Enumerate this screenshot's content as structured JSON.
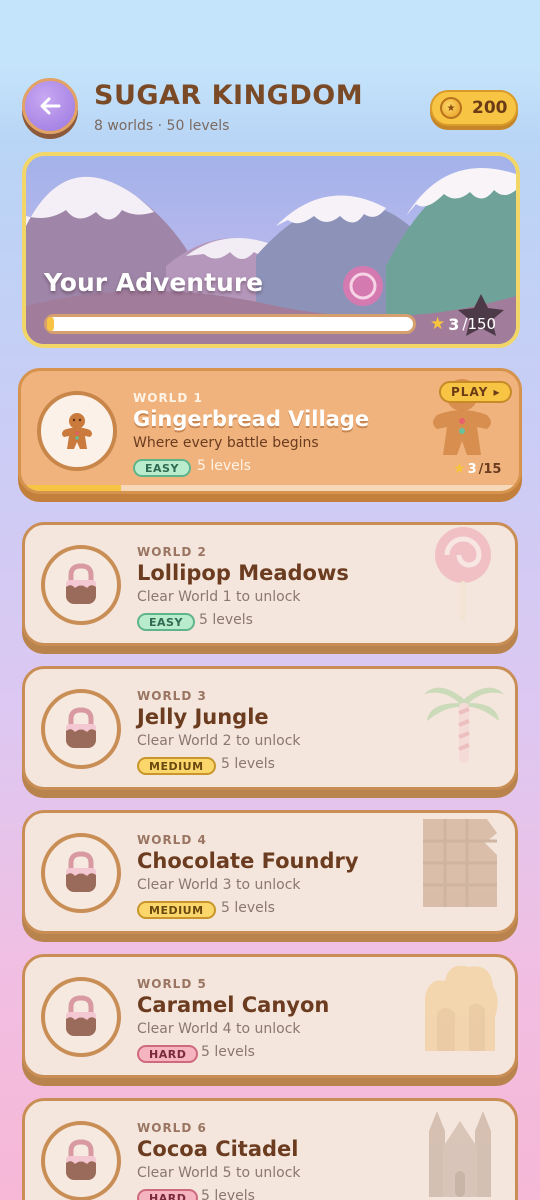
{
  "header": {
    "title": "SUGAR KINGDOM",
    "subtitle": "8 worlds · 50 levels",
    "coins": "200"
  },
  "banner": {
    "title": "Your Adventure",
    "stars_collected": "3",
    "stars_total": "/150",
    "progress_fraction": 0.02
  },
  "worlds": [
    {
      "number": "WORLD 1",
      "name": "Gingerbread Village",
      "description": "Where every battle begins",
      "difficulty": "EASY",
      "levels": "5 levels",
      "action": "PLAY ▸",
      "stars": "3",
      "stars_total": "/15",
      "progress_fraction": 0.2,
      "icon": "gingerbread-man-icon",
      "status": "unlocked"
    },
    {
      "number": "WORLD 2",
      "name": "Lollipop Meadows",
      "description": "Clear World 1 to unlock",
      "difficulty": "EASY",
      "levels": "5 levels",
      "icon": "lock-icon",
      "status": "locked"
    },
    {
      "number": "WORLD 3",
      "name": "Jelly Jungle",
      "description": "Clear World 2 to unlock",
      "difficulty": "MEDIUM",
      "levels": "5 levels",
      "icon": "lock-icon",
      "status": "locked"
    },
    {
      "number": "WORLD 4",
      "name": "Chocolate Foundry",
      "description": "Clear World 3 to unlock",
      "difficulty": "MEDIUM",
      "levels": "5 levels",
      "icon": "lock-icon",
      "status": "locked"
    },
    {
      "number": "WORLD 5",
      "name": "Caramel Canyon",
      "description": "Clear World 4 to unlock",
      "difficulty": "HARD",
      "levels": "5 levels",
      "icon": "lock-icon",
      "status": "locked"
    },
    {
      "number": "WORLD 6",
      "name": "Cocoa Citadel",
      "description": "Clear World 5 to unlock",
      "difficulty": "HARD",
      "levels": "5 levels",
      "icon": "lock-icon",
      "status": "locked"
    }
  ],
  "colors": {
    "title_brown": "#7a4a26",
    "coin_gold": "#f7c444",
    "active_card": "#f0b37d",
    "locked_card": "#f4e6dc",
    "back_button_purple": "#9b78e0"
  }
}
